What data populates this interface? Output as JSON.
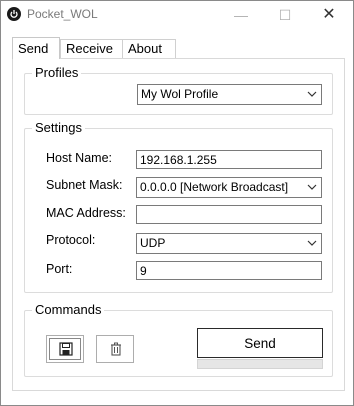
{
  "window": {
    "title": "Pocket_WOL",
    "minimize_glyph": "—",
    "maximize_glyph": "☐",
    "close_glyph": "✕"
  },
  "tabs": [
    {
      "label": "Send",
      "active": true
    },
    {
      "label": "Receive",
      "active": false
    },
    {
      "label": "About",
      "active": false
    }
  ],
  "profiles": {
    "title": "Profiles",
    "selected": "My Wol Profile"
  },
  "settings": {
    "title": "Settings",
    "host_name": {
      "label": "Host Name:",
      "value": "192.168.1.255"
    },
    "subnet_mask": {
      "label": "Subnet Mask:",
      "value": "0.0.0.0 [Network Broadcast]"
    },
    "mac_address": {
      "label": "MAC Address:",
      "value": ""
    },
    "protocol": {
      "label": "Protocol:",
      "value": "UDP"
    },
    "port": {
      "label": "Port:",
      "value": "9"
    }
  },
  "commands": {
    "title": "Commands",
    "save_icon": "save-icon",
    "delete_icon": "trash-icon",
    "send_label": "Send",
    "progress": 0
  }
}
